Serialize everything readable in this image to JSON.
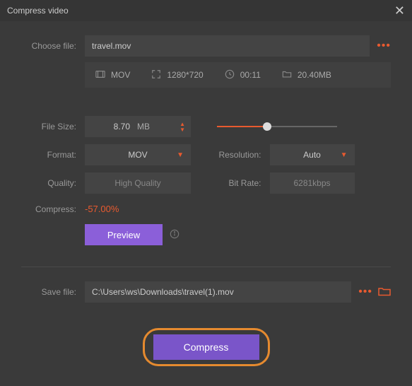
{
  "window": {
    "title": "Compress video"
  },
  "choose": {
    "label": "Choose file:",
    "value": "travel.mov"
  },
  "meta": {
    "format": "MOV",
    "resolution": "1280*720",
    "duration": "00:11",
    "size": "20.40MB"
  },
  "filesize": {
    "label": "File Size:",
    "value": "8.70",
    "unit": "MB"
  },
  "format": {
    "label": "Format:",
    "value": "MOV"
  },
  "resolutionSel": {
    "label": "Resolution:",
    "value": "Auto"
  },
  "quality": {
    "label": "Quality:",
    "value": "High Quality"
  },
  "bitrate": {
    "label": "Bit Rate:",
    "value": "6281kbps"
  },
  "compress": {
    "label": "Compress:",
    "value": "-57.00%"
  },
  "buttons": {
    "preview": "Preview",
    "compress": "Compress"
  },
  "save": {
    "label": "Save file:",
    "value": "C:\\Users\\ws\\Downloads\\travel(1).mov"
  }
}
